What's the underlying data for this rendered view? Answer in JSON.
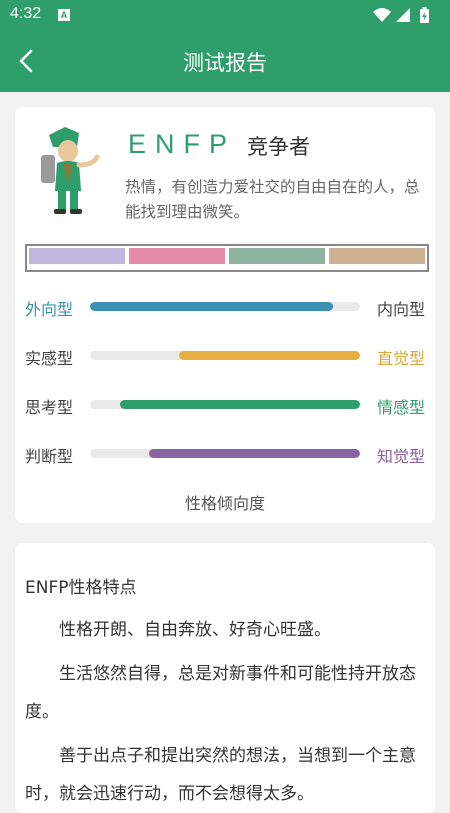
{
  "status_bar": {
    "time": "4:32",
    "notification_icon": "A"
  },
  "header": {
    "title": "测试报告"
  },
  "profile": {
    "type_code": "ENFP",
    "type_name": "竞争者",
    "description": "热情，有创造力爱社交的自由自在的人，总能找到理由微笑。",
    "palette": [
      "#bfb7dc",
      "#e48ca7",
      "#8eb3a1",
      "#cfb296"
    ]
  },
  "traits": [
    {
      "left": "外向型",
      "right": "内向型",
      "pole": "left",
      "percent": 90,
      "color": "#3a91b0",
      "left_color": "#3a91b0",
      "right_color": "#444444"
    },
    {
      "left": "实感型",
      "right": "直觉型",
      "pole": "right",
      "percent": 67,
      "color": "#e6b040",
      "left_color": "#444444",
      "right_color": "#d7a93b"
    },
    {
      "left": "思考型",
      "right": "情感型",
      "pole": "right",
      "percent": 89,
      "color": "#2e9e6b",
      "left_color": "#444444",
      "right_color": "#2e9e6b"
    },
    {
      "left": "判断型",
      "right": "知觉型",
      "pole": "right",
      "percent": 78,
      "color": "#8a63a1",
      "left_color": "#444444",
      "right_color": "#8a63a1"
    }
  ],
  "axis_caption": "性格倾向度",
  "features": {
    "title": "ENFP性格特点",
    "paragraphs": [
      "性格开朗、自由奔放、好奇心旺盛。",
      "生活悠然自得，总是对新事件和可能性持开放态度。",
      "善于出点子和提出突然的想法，当想到一个主意时，就会迅速行动，而不会想得太多。"
    ]
  }
}
